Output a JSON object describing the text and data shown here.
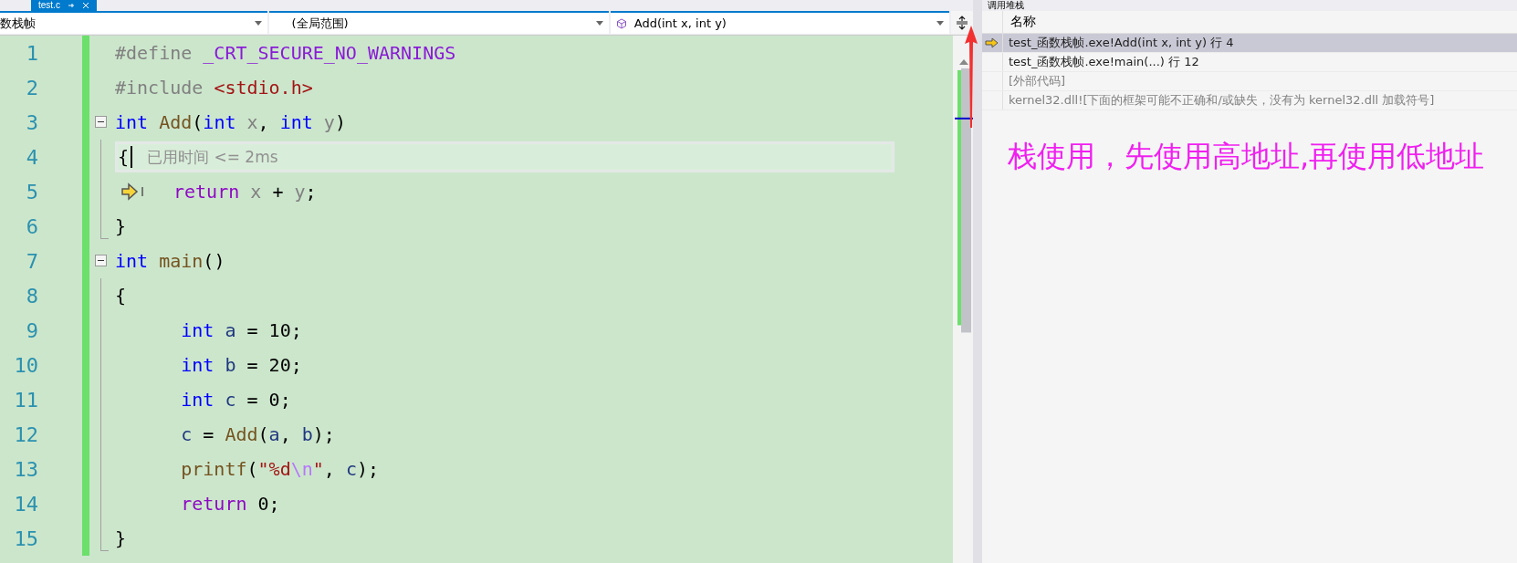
{
  "document_tab": {
    "label": "test.c",
    "selected": true
  },
  "navigation_bar": {
    "project": "数栈帧",
    "scope": "(全局范围)",
    "member": "Add(int x, int y)"
  },
  "code_lines": [
    {
      "number": "1",
      "changed": true,
      "kind": "plain",
      "tokens": [
        {
          "text": "#define ",
          "kind": "pre"
        },
        {
          "text": "_CRT_SECURE_NO_WARNINGS",
          "kind": "macro"
        }
      ]
    },
    {
      "number": "2",
      "changed": true,
      "kind": "plain",
      "tokens": [
        {
          "text": "#include ",
          "kind": "pre"
        },
        {
          "text": "<stdio.h>",
          "kind": "str"
        }
      ]
    },
    {
      "number": "3",
      "changed": true,
      "kind": "block_start",
      "expanded": true,
      "tokens": [
        {
          "text": "int ",
          "kind": "kw"
        },
        {
          "text": "Add",
          "kind": "fn"
        },
        {
          "text": "(",
          "kind": "plain"
        },
        {
          "text": "int ",
          "kind": "kw"
        },
        {
          "text": "x",
          "kind": "param"
        },
        {
          "text": ", ",
          "kind": "plain"
        },
        {
          "text": "int ",
          "kind": "kw"
        },
        {
          "text": "y",
          "kind": "param"
        },
        {
          "text": ")",
          "kind": "plain"
        }
      ]
    },
    {
      "number": "4",
      "changed": true,
      "kind": "block_inner",
      "current": true,
      "hint": "已用时间 <= 2ms",
      "tokens": [
        {
          "text": "{",
          "kind": "plain"
        }
      ]
    },
    {
      "number": "5",
      "changed": true,
      "kind": "block_inner",
      "instruction_pointer": true,
      "tokens": [
        {
          "text": "return ",
          "kind": "ctrl"
        },
        {
          "text": "x",
          "kind": "param"
        },
        {
          "text": " + ",
          "kind": "plain"
        },
        {
          "text": "y",
          "kind": "param"
        },
        {
          "text": ";",
          "kind": "plain"
        }
      ]
    },
    {
      "number": "6",
      "changed": true,
      "kind": "block_end",
      "tokens": [
        {
          "text": "}",
          "kind": "plain"
        }
      ]
    },
    {
      "number": "7",
      "changed": true,
      "kind": "block_start",
      "expanded": true,
      "tokens": [
        {
          "text": "int ",
          "kind": "kw"
        },
        {
          "text": "main",
          "kind": "fn"
        },
        {
          "text": "()",
          "kind": "plain"
        }
      ]
    },
    {
      "number": "8",
      "changed": true,
      "kind": "block_inner",
      "tokens": [
        {
          "text": "{",
          "kind": "plain"
        }
      ]
    },
    {
      "number": "9",
      "changed": true,
      "kind": "block_inner",
      "tokens": [
        {
          "text": "      int ",
          "kind": "kw"
        },
        {
          "text": "a",
          "kind": "local"
        },
        {
          "text": " = 10;",
          "kind": "plain"
        }
      ]
    },
    {
      "number": "10",
      "changed": true,
      "kind": "block_inner",
      "tokens": [
        {
          "text": "      int ",
          "kind": "kw"
        },
        {
          "text": "b",
          "kind": "local"
        },
        {
          "text": " = 20;",
          "kind": "plain"
        }
      ]
    },
    {
      "number": "11",
      "changed": true,
      "kind": "block_inner",
      "tokens": [
        {
          "text": "      int ",
          "kind": "kw"
        },
        {
          "text": "c",
          "kind": "local"
        },
        {
          "text": " = 0;",
          "kind": "plain"
        }
      ]
    },
    {
      "number": "12",
      "changed": true,
      "kind": "block_inner",
      "tokens": [
        {
          "text": "      c",
          "kind": "local"
        },
        {
          "text": " = ",
          "kind": "plain"
        },
        {
          "text": "Add",
          "kind": "fn"
        },
        {
          "text": "(",
          "kind": "plain"
        },
        {
          "text": "a",
          "kind": "local"
        },
        {
          "text": ", ",
          "kind": "plain"
        },
        {
          "text": "b",
          "kind": "local"
        },
        {
          "text": ");",
          "kind": "plain"
        }
      ]
    },
    {
      "number": "13",
      "changed": true,
      "kind": "block_inner",
      "tokens": [
        {
          "text": "      printf",
          "kind": "fn"
        },
        {
          "text": "(",
          "kind": "plain"
        },
        {
          "text": "\"%d",
          "kind": "str"
        },
        {
          "text": "\\n",
          "kind": "esc"
        },
        {
          "text": "\"",
          "kind": "str"
        },
        {
          "text": ", ",
          "kind": "plain"
        },
        {
          "text": "c",
          "kind": "local"
        },
        {
          "text": ");",
          "kind": "plain"
        }
      ]
    },
    {
      "number": "14",
      "changed": true,
      "kind": "block_inner",
      "tokens": [
        {
          "text": "      return",
          "kind": "ctrl"
        },
        {
          "text": " 0;",
          "kind": "plain"
        }
      ]
    },
    {
      "number": "15",
      "changed": true,
      "kind": "block_end",
      "tokens": [
        {
          "text": "}",
          "kind": "plain"
        }
      ]
    }
  ],
  "call_stack": {
    "title": "调用堆栈",
    "column": "名称",
    "frames": [
      {
        "text": "test_函数栈帧.exe!Add(int x, int y) 行 4",
        "current": true,
        "dimmed": false
      },
      {
        "text": "test_函数栈帧.exe!main(...) 行 12",
        "current": false,
        "dimmed": false
      },
      {
        "text": "[外部代码]",
        "current": false,
        "dimmed": true
      },
      {
        "text": "kernel32.dll![下面的框架可能不正确和/或缺失，没有为 kernel32.dll 加载符号]",
        "current": false,
        "dimmed": true
      }
    ]
  },
  "annotation": {
    "text": "栈使用，先使用高地址,再使用低地址",
    "color": "#f01ff0"
  }
}
